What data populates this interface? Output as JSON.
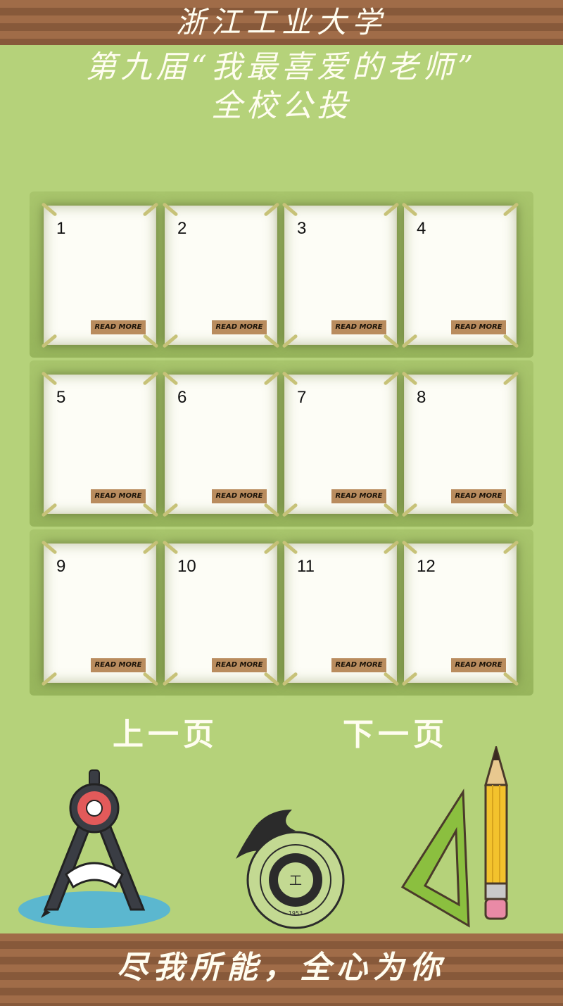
{
  "header": {
    "university": "浙江工业大学",
    "event_line": "第九届“我最喜爱的老师”",
    "vote_line": "全校公投"
  },
  "cards": [
    {
      "number": "1",
      "action": "READ MORE"
    },
    {
      "number": "2",
      "action": "READ MORE"
    },
    {
      "number": "3",
      "action": "READ MORE"
    },
    {
      "number": "4",
      "action": "READ MORE"
    },
    {
      "number": "5",
      "action": "READ MORE"
    },
    {
      "number": "6",
      "action": "READ MORE"
    },
    {
      "number": "7",
      "action": "READ MORE"
    },
    {
      "number": "8",
      "action": "READ MORE"
    },
    {
      "number": "9",
      "action": "READ MORE"
    },
    {
      "number": "10",
      "action": "READ MORE"
    },
    {
      "number": "11",
      "action": "READ MORE"
    },
    {
      "number": "12",
      "action": "READ MORE"
    }
  ],
  "pagination": {
    "prev_label": "上一页",
    "next_label": "下一页"
  },
  "footer": {
    "slogan": "尽我所能，全心为你"
  },
  "emblem": {
    "year": "1953",
    "ring_text": "ZHEJIANG UNIVERSITY OF TECHNOLOGY STUDENT UNION"
  },
  "icons": [
    "compass-icon",
    "university-emblem",
    "set-square-icon",
    "pencil-icon"
  ],
  "colors": {
    "background": "#b5d27a",
    "stripe_dark": "#87593a",
    "stripe_light": "#a06c48",
    "card": "#fdfdf6",
    "read_more_bg": "#b98c5e"
  }
}
